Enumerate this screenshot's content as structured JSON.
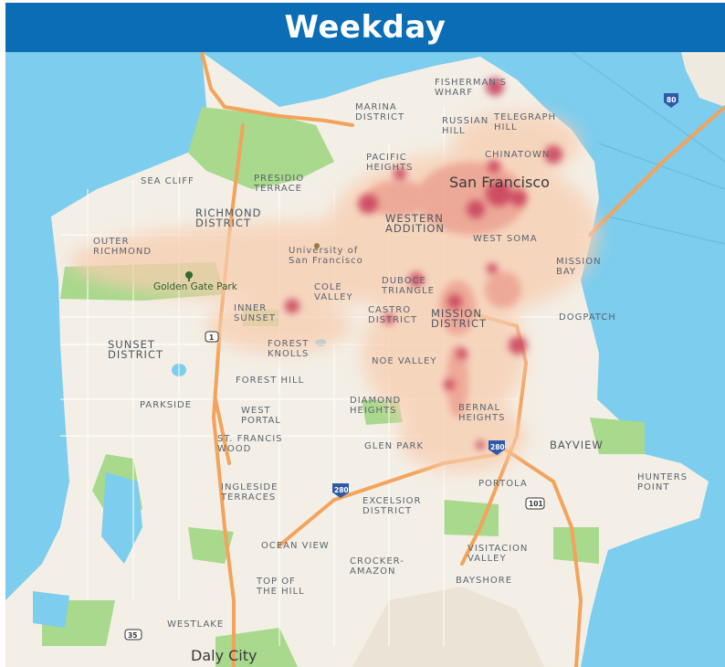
{
  "title": "Weekday",
  "colors": {
    "header_bg": "#0a6db6",
    "water": "#7ccdee",
    "land": "#f3efe6",
    "park": "#a8d98c",
    "highway": "#f3a35a",
    "heat_low": "#f8cdb0",
    "heat_high": "#c83c5a"
  },
  "map": {
    "labels": [
      {
        "name": "fishermans-wharf-label",
        "lines": [
          "FISHERMAN'S",
          "WHARF"
        ]
      },
      {
        "name": "marina-district-label",
        "lines": [
          "MARINA",
          "DISTRICT"
        ]
      },
      {
        "name": "russian-hill-label",
        "lines": [
          "RUSSIAN",
          "HILL"
        ]
      },
      {
        "name": "telegraph-hill-label",
        "lines": [
          "TELEGRAPH",
          "HILL"
        ]
      },
      {
        "name": "chinatown-label",
        "lines": [
          "CHINATOWN"
        ]
      },
      {
        "name": "pacific-heights-label",
        "lines": [
          "PACIFIC",
          "HEIGHTS"
        ]
      },
      {
        "name": "sea-cliff-label",
        "lines": [
          "SEA CLIFF"
        ]
      },
      {
        "name": "presidio-terrace-label",
        "lines": [
          "PRESIDIO",
          "TERRACE"
        ]
      },
      {
        "name": "richmond-district-label",
        "lines": [
          "RICHMOND",
          "DISTRICT"
        ]
      },
      {
        "name": "western-addition-label",
        "lines": [
          "WESTERN",
          "ADDITION"
        ]
      },
      {
        "name": "outer-richmond-label",
        "lines": [
          "OUTER",
          "RICHMOND"
        ]
      },
      {
        "name": "university-label",
        "lines": [
          "University of",
          "San Francisco"
        ]
      },
      {
        "name": "west-soma-label",
        "lines": [
          "WEST SOMA"
        ]
      },
      {
        "name": "mission-bay-label",
        "lines": [
          "MISSION",
          "BAY"
        ]
      },
      {
        "name": "golden-gate-park-label",
        "lines": [
          "Golden Gate Park"
        ]
      },
      {
        "name": "cole-valley-label",
        "lines": [
          "COLE",
          "VALLEY"
        ]
      },
      {
        "name": "duboce-triangle-label",
        "lines": [
          "DUBOCE",
          "TRIANGLE"
        ]
      },
      {
        "name": "inner-sunset-label",
        "lines": [
          "INNER",
          "SUNSET"
        ]
      },
      {
        "name": "castro-label",
        "lines": [
          "CASTRO",
          "DISTRICT"
        ]
      },
      {
        "name": "mission-district-label",
        "lines": [
          "MISSION",
          "DISTRICT"
        ]
      },
      {
        "name": "dogpatch-label",
        "lines": [
          "DOGPATCH"
        ]
      },
      {
        "name": "sunset-district-label",
        "lines": [
          "SUNSET",
          "DISTRICT"
        ]
      },
      {
        "name": "forest-knolls-label",
        "lines": [
          "FOREST",
          "KNOLLS"
        ]
      },
      {
        "name": "noe-valley-label",
        "lines": [
          "NOE VALLEY"
        ]
      },
      {
        "name": "forest-hill-label",
        "lines": [
          "FOREST HILL"
        ]
      },
      {
        "name": "parkside-label",
        "lines": [
          "PARKSIDE"
        ]
      },
      {
        "name": "west-portal-label",
        "lines": [
          "WEST",
          "PORTAL"
        ]
      },
      {
        "name": "diamond-heights-label",
        "lines": [
          "DIAMOND",
          "HEIGHTS"
        ]
      },
      {
        "name": "bernal-heights-label",
        "lines": [
          "BERNAL",
          "HEIGHTS"
        ]
      },
      {
        "name": "st-francis-wood-label",
        "lines": [
          "ST. FRANCIS",
          "WOOD"
        ]
      },
      {
        "name": "glen-park-label",
        "lines": [
          "GLEN PARK"
        ]
      },
      {
        "name": "bayview-label",
        "lines": [
          "BAYVIEW"
        ]
      },
      {
        "name": "ingleside-terraces-label",
        "lines": [
          "INGLESIDE",
          "TERRACES"
        ]
      },
      {
        "name": "portola-label",
        "lines": [
          "PORTOLA"
        ]
      },
      {
        "name": "hunters-point-label",
        "lines": [
          "HUNTERS",
          "POINT"
        ]
      },
      {
        "name": "excelsior-label",
        "lines": [
          "EXCELSIOR",
          "DISTRICT"
        ]
      },
      {
        "name": "ocean-view-label",
        "lines": [
          "OCEAN VIEW"
        ]
      },
      {
        "name": "crocker-amazon-label",
        "lines": [
          "CROCKER-",
          "AMAZON"
        ]
      },
      {
        "name": "visitacion-valley-label",
        "lines": [
          "VISITACION",
          "VALLEY"
        ]
      },
      {
        "name": "top-of-the-hill-label",
        "lines": [
          "TOP OF",
          "THE HILL"
        ]
      },
      {
        "name": "bayshore-label",
        "lines": [
          "BAYSHORE"
        ]
      },
      {
        "name": "westlake-label",
        "lines": [
          "WESTLAKE"
        ]
      }
    ],
    "city_labels": {
      "san_francisco": "San Francisco",
      "daly_city": "Daly City"
    },
    "shields": {
      "i80": "80",
      "i280_a": "280",
      "i280_b": "280",
      "us101": "101",
      "ca1": "1",
      "ca35": "35"
    },
    "heatmap_hotspots": [
      {
        "place": "Fisherman's Wharf",
        "intensity": 0.95
      },
      {
        "place": "Chinatown",
        "intensity": 0.95
      },
      {
        "place": "Financial District",
        "intensity": 1.0
      },
      {
        "place": "Union Square",
        "intensity": 0.9
      },
      {
        "place": "Pacific Heights",
        "intensity": 0.85
      },
      {
        "place": "Duboce Triangle",
        "intensity": 0.75
      },
      {
        "place": "Inner Sunset",
        "intensity": 0.75
      },
      {
        "place": "Mission District",
        "intensity": 0.8
      },
      {
        "place": "Potrero / Dogpatch",
        "intensity": 0.85
      },
      {
        "place": "Bernal Heights",
        "intensity": 0.6
      },
      {
        "place": "Castro",
        "intensity": 0.6
      }
    ]
  }
}
